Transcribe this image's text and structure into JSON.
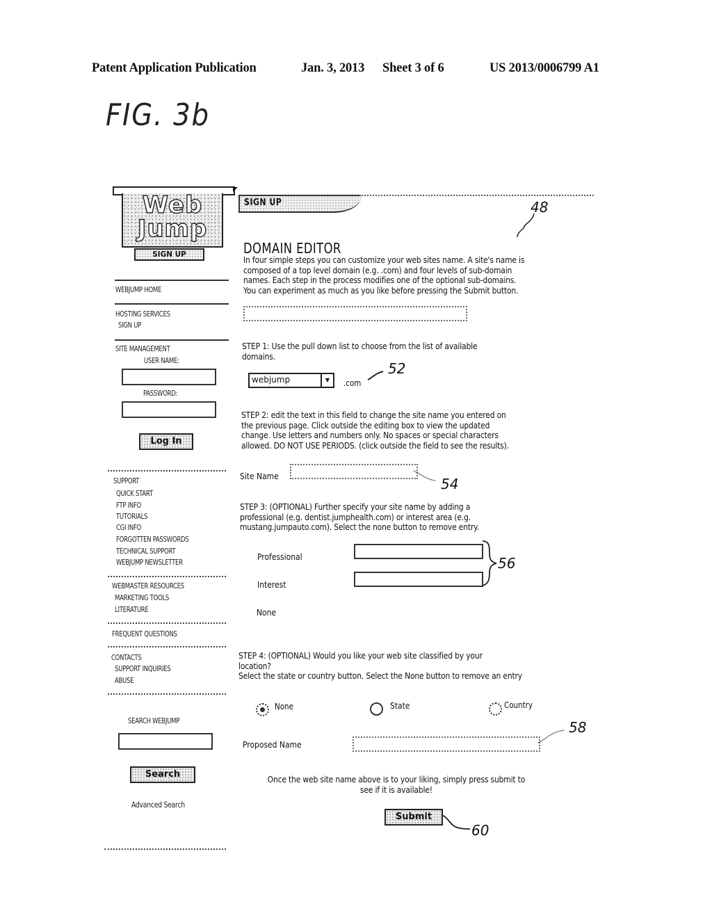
{
  "patent_header": {
    "left": "Patent Application Publication",
    "date": "Jan. 3, 2013",
    "sheet": "Sheet 3 of 6",
    "number": "US 2013/0006799 A1"
  },
  "figure_label": "FIG. 3b",
  "logo": {
    "line1": "Web",
    "line2": "Jump",
    "signup_label": "SIGN UP"
  },
  "sidebar": {
    "home": "WEBJUMP HOME",
    "hosting": {
      "heading": "HOSTING SERVICES",
      "item": "SIGN UP"
    },
    "site_management": {
      "heading": "SITE MANAGEMENT",
      "username_label": "USER NAME:",
      "username_value": "",
      "password_label": "PASSWORD:",
      "password_value": "",
      "login_button": "Log In"
    },
    "support": {
      "heading": "SUPPORT",
      "items": [
        "QUICK START",
        "FTP INFO",
        "TUTORIALS",
        "CGI INFO",
        "FORGOTTEN PASSWORDS",
        "TECHNICAL SUPPORT",
        "WEBJUMP NEWSLETTER"
      ]
    },
    "webmaster": {
      "heading": "WEBMASTER RESOURCES",
      "items": [
        "MARKETING  TOOLS",
        "LITERATURE"
      ]
    },
    "faq": "FREQUENT QUESTIONS",
    "contacts": {
      "heading": "CONTACTS",
      "items": [
        "SUPPORT INQUIRIES",
        "ABUSE"
      ]
    },
    "search": {
      "label": "SEARCH WEBJUMP",
      "value": "",
      "button": "Search",
      "advanced": "Advanced Search"
    }
  },
  "main": {
    "tab_label": "SIGN UP",
    "title": "DOMAIN EDITOR",
    "intro": "In four simple steps you can customize your web sites name.  A site's name is\ncomposed of a top level domain (e.g. .com) and four levels of sub-domain\nnames.  Each step in the process modifies one of the optional sub-domains.\nYou can experiment as much as you like before pressing the Submit button.",
    "preview_value": "",
    "step1": {
      "text": "STEP 1: Use the pull down list to choose from the list of available\ndomains.",
      "select_value": "webjump",
      "suffix": ".com"
    },
    "step2": {
      "text": "STEP 2: edit the text in this field to change the site name you entered on\nthe previous page.  Click outside the editing box to view the updated\nchange.  Use letters and numbers only.  No spaces or special characters\nallowed.  DO NOT USE PERIODS.  (click outside the field to see the results).",
      "site_name_label": "Site Name",
      "site_name_value": ""
    },
    "step3": {
      "text": "STEP 3:  (OPTIONAL) Further specify your site name by adding a\nprofessional (e.g. dentist.jumphealth.com) or interest area (e.g.\nmustang.jumpauto.com).  Select the none button to remove entry.",
      "professional_label": "Professional",
      "professional_value": "",
      "interest_label": "Interest",
      "interest_value": "",
      "none_label": "None"
    },
    "step4": {
      "text": "STEP 4: (OPTIONAL) Would you like your web site classified by your\nlocation?\nSelect the state or country button.  Select the None button to remove an entry",
      "options": [
        {
          "label": "None",
          "selected": true
        },
        {
          "label": "State",
          "selected": false
        },
        {
          "label": "Country",
          "selected": false
        }
      ],
      "proposed_label": "Proposed Name",
      "proposed_value": ""
    },
    "closing_text": "Once the web site name above is to your liking, simply press submit to\nsee if it is available!",
    "submit_button": "Submit"
  },
  "reference_numerals": {
    "page": "48",
    "domain_select": "52",
    "site_name": "54",
    "subdomain_fields": "56",
    "proposed_name": "58",
    "submit": "60"
  }
}
